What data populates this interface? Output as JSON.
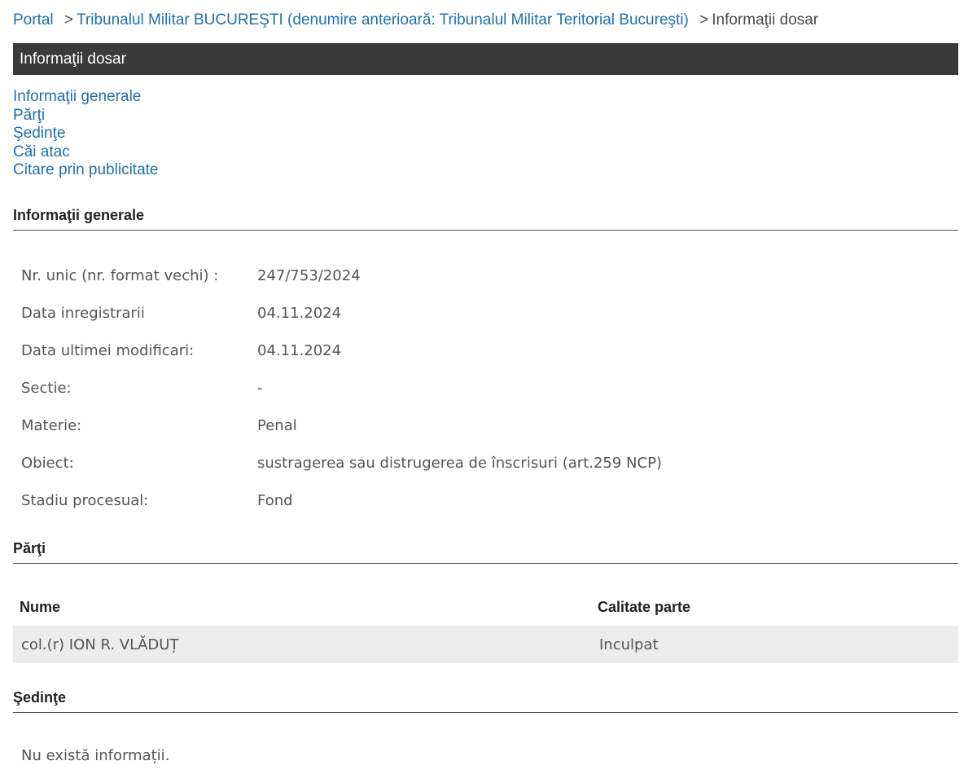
{
  "breadcrumb": {
    "portal": "Portal",
    "sep": ">",
    "court": "Tribunalul Militar BUCUREŞTI (denumire anterioară: Tribunalul Militar Teritorial Bucureşti)",
    "current": "Informaţii dosar"
  },
  "page_title": "Informaţii dosar",
  "anchors": [
    {
      "label": "Informaţii generale"
    },
    {
      "label": "Părţi"
    },
    {
      "label": "Şedinţe"
    },
    {
      "label": "Căi atac"
    },
    {
      "label": "Citare prin publicitate"
    }
  ],
  "general": {
    "heading": "Informaţii generale",
    "rows": [
      {
        "label": "Nr. unic (nr. format vechi) :",
        "value": "247/753/2024"
      },
      {
        "label": "Data inregistrarii",
        "value": "04.11.2024"
      },
      {
        "label": "Data ultimei modificari:",
        "value": "04.11.2024"
      },
      {
        "label": "Sectie:",
        "value": "-"
      },
      {
        "label": "Materie:",
        "value": "Penal"
      },
      {
        "label": "Obiect:",
        "value": "sustragerea sau distrugerea de înscrisuri (art.259 NCP)"
      },
      {
        "label": "Stadiu procesual:",
        "value": "Fond"
      }
    ]
  },
  "parti": {
    "heading": "Părţi",
    "columns": [
      "Nume",
      "Calitate parte"
    ],
    "rows": [
      {
        "nume": "col.(r) ION R. VLĂDUȚ",
        "calitate": "Inculpat"
      }
    ]
  },
  "sedinte": {
    "heading": "Şedinţe",
    "empty": "Nu există informații."
  },
  "colors": {
    "link": "#1f6fae",
    "titlebar_bg": "#3a3a3a",
    "row_bg": "#ececec"
  }
}
